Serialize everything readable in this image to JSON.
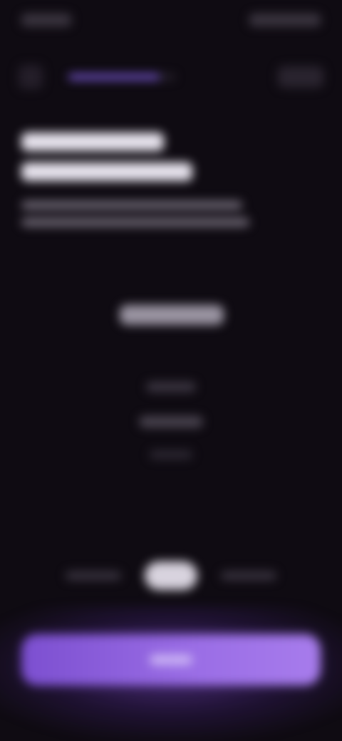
{
  "colors": {
    "background": "#0f0b12",
    "accent": "#7a58d6",
    "cta_start": "#7c4fd0",
    "cta_end": "#a77cec",
    "heading_text": "#e8e4ee",
    "muted_text": "#6f6875"
  },
  "top_nav": {
    "back_icon": "chevron-left-icon",
    "progress_fraction": 0.85
  },
  "picker": {
    "selected_index": 0
  },
  "segmented": {
    "active_index": 1,
    "segment_count": 3
  }
}
